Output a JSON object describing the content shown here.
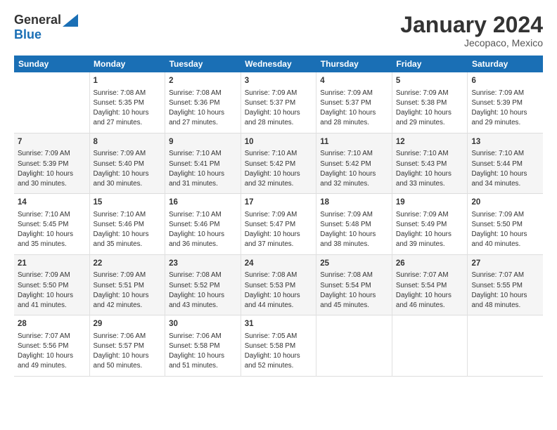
{
  "header": {
    "logo_general": "General",
    "logo_blue": "Blue",
    "main_title": "January 2024",
    "subtitle": "Jecopaco, Mexico"
  },
  "calendar": {
    "days_of_week": [
      "Sunday",
      "Monday",
      "Tuesday",
      "Wednesday",
      "Thursday",
      "Friday",
      "Saturday"
    ],
    "weeks": [
      [
        {
          "day": "",
          "info": ""
        },
        {
          "day": "1",
          "info": "Sunrise: 7:08 AM\nSunset: 5:35 PM\nDaylight: 10 hours\nand 27 minutes."
        },
        {
          "day": "2",
          "info": "Sunrise: 7:08 AM\nSunset: 5:36 PM\nDaylight: 10 hours\nand 27 minutes."
        },
        {
          "day": "3",
          "info": "Sunrise: 7:09 AM\nSunset: 5:37 PM\nDaylight: 10 hours\nand 28 minutes."
        },
        {
          "day": "4",
          "info": "Sunrise: 7:09 AM\nSunset: 5:37 PM\nDaylight: 10 hours\nand 28 minutes."
        },
        {
          "day": "5",
          "info": "Sunrise: 7:09 AM\nSunset: 5:38 PM\nDaylight: 10 hours\nand 29 minutes."
        },
        {
          "day": "6",
          "info": "Sunrise: 7:09 AM\nSunset: 5:39 PM\nDaylight: 10 hours\nand 29 minutes."
        }
      ],
      [
        {
          "day": "7",
          "info": "Sunrise: 7:09 AM\nSunset: 5:39 PM\nDaylight: 10 hours\nand 30 minutes."
        },
        {
          "day": "8",
          "info": "Sunrise: 7:09 AM\nSunset: 5:40 PM\nDaylight: 10 hours\nand 30 minutes."
        },
        {
          "day": "9",
          "info": "Sunrise: 7:10 AM\nSunset: 5:41 PM\nDaylight: 10 hours\nand 31 minutes."
        },
        {
          "day": "10",
          "info": "Sunrise: 7:10 AM\nSunset: 5:42 PM\nDaylight: 10 hours\nand 32 minutes."
        },
        {
          "day": "11",
          "info": "Sunrise: 7:10 AM\nSunset: 5:42 PM\nDaylight: 10 hours\nand 32 minutes."
        },
        {
          "day": "12",
          "info": "Sunrise: 7:10 AM\nSunset: 5:43 PM\nDaylight: 10 hours\nand 33 minutes."
        },
        {
          "day": "13",
          "info": "Sunrise: 7:10 AM\nSunset: 5:44 PM\nDaylight: 10 hours\nand 34 minutes."
        }
      ],
      [
        {
          "day": "14",
          "info": "Sunrise: 7:10 AM\nSunset: 5:45 PM\nDaylight: 10 hours\nand 35 minutes."
        },
        {
          "day": "15",
          "info": "Sunrise: 7:10 AM\nSunset: 5:46 PM\nDaylight: 10 hours\nand 35 minutes."
        },
        {
          "day": "16",
          "info": "Sunrise: 7:10 AM\nSunset: 5:46 PM\nDaylight: 10 hours\nand 36 minutes."
        },
        {
          "day": "17",
          "info": "Sunrise: 7:09 AM\nSunset: 5:47 PM\nDaylight: 10 hours\nand 37 minutes."
        },
        {
          "day": "18",
          "info": "Sunrise: 7:09 AM\nSunset: 5:48 PM\nDaylight: 10 hours\nand 38 minutes."
        },
        {
          "day": "19",
          "info": "Sunrise: 7:09 AM\nSunset: 5:49 PM\nDaylight: 10 hours\nand 39 minutes."
        },
        {
          "day": "20",
          "info": "Sunrise: 7:09 AM\nSunset: 5:50 PM\nDaylight: 10 hours\nand 40 minutes."
        }
      ],
      [
        {
          "day": "21",
          "info": "Sunrise: 7:09 AM\nSunset: 5:50 PM\nDaylight: 10 hours\nand 41 minutes."
        },
        {
          "day": "22",
          "info": "Sunrise: 7:09 AM\nSunset: 5:51 PM\nDaylight: 10 hours\nand 42 minutes."
        },
        {
          "day": "23",
          "info": "Sunrise: 7:08 AM\nSunset: 5:52 PM\nDaylight: 10 hours\nand 43 minutes."
        },
        {
          "day": "24",
          "info": "Sunrise: 7:08 AM\nSunset: 5:53 PM\nDaylight: 10 hours\nand 44 minutes."
        },
        {
          "day": "25",
          "info": "Sunrise: 7:08 AM\nSunset: 5:54 PM\nDaylight: 10 hours\nand 45 minutes."
        },
        {
          "day": "26",
          "info": "Sunrise: 7:07 AM\nSunset: 5:54 PM\nDaylight: 10 hours\nand 46 minutes."
        },
        {
          "day": "27",
          "info": "Sunrise: 7:07 AM\nSunset: 5:55 PM\nDaylight: 10 hours\nand 48 minutes."
        }
      ],
      [
        {
          "day": "28",
          "info": "Sunrise: 7:07 AM\nSunset: 5:56 PM\nDaylight: 10 hours\nand 49 minutes."
        },
        {
          "day": "29",
          "info": "Sunrise: 7:06 AM\nSunset: 5:57 PM\nDaylight: 10 hours\nand 50 minutes."
        },
        {
          "day": "30",
          "info": "Sunrise: 7:06 AM\nSunset: 5:58 PM\nDaylight: 10 hours\nand 51 minutes."
        },
        {
          "day": "31",
          "info": "Sunrise: 7:05 AM\nSunset: 5:58 PM\nDaylight: 10 hours\nand 52 minutes."
        },
        {
          "day": "",
          "info": ""
        },
        {
          "day": "",
          "info": ""
        },
        {
          "day": "",
          "info": ""
        }
      ]
    ]
  }
}
